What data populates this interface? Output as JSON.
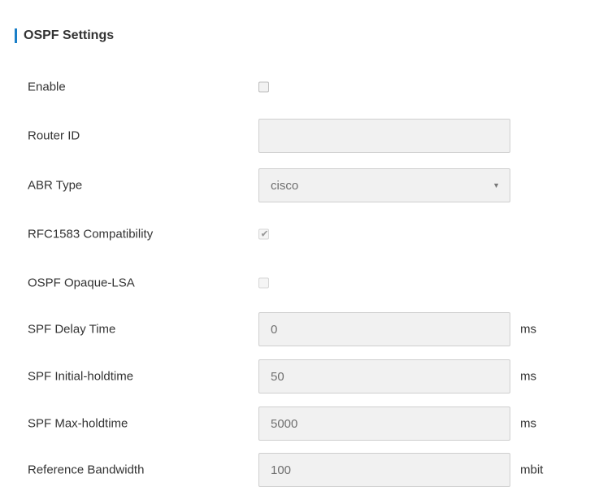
{
  "section": {
    "title": "OSPF Settings",
    "accent_color": "#1a7fc8"
  },
  "fields": {
    "enable": {
      "label": "Enable",
      "checked": false,
      "disabled": false
    },
    "router_id": {
      "label": "Router ID",
      "value": ""
    },
    "abr_type": {
      "label": "ABR Type",
      "selected": "cisco"
    },
    "rfc1583": {
      "label": "RFC1583 Compatibility",
      "checked": true,
      "disabled": true,
      "check_glyph": "✔"
    },
    "opaque_lsa": {
      "label": "OSPF Opaque-LSA",
      "checked": false,
      "disabled": true
    },
    "spf_delay": {
      "label": "SPF Delay Time",
      "value": "0",
      "unit": "ms"
    },
    "spf_initial_holdtime": {
      "label": "SPF Initial-holdtime",
      "value": "50",
      "unit": "ms"
    },
    "spf_max_holdtime": {
      "label": "SPF Max-holdtime",
      "value": "5000",
      "unit": "ms"
    },
    "reference_bandwidth": {
      "label": "Reference Bandwidth",
      "value": "100",
      "unit": "mbit"
    }
  },
  "icons": {
    "caret": "▼"
  }
}
